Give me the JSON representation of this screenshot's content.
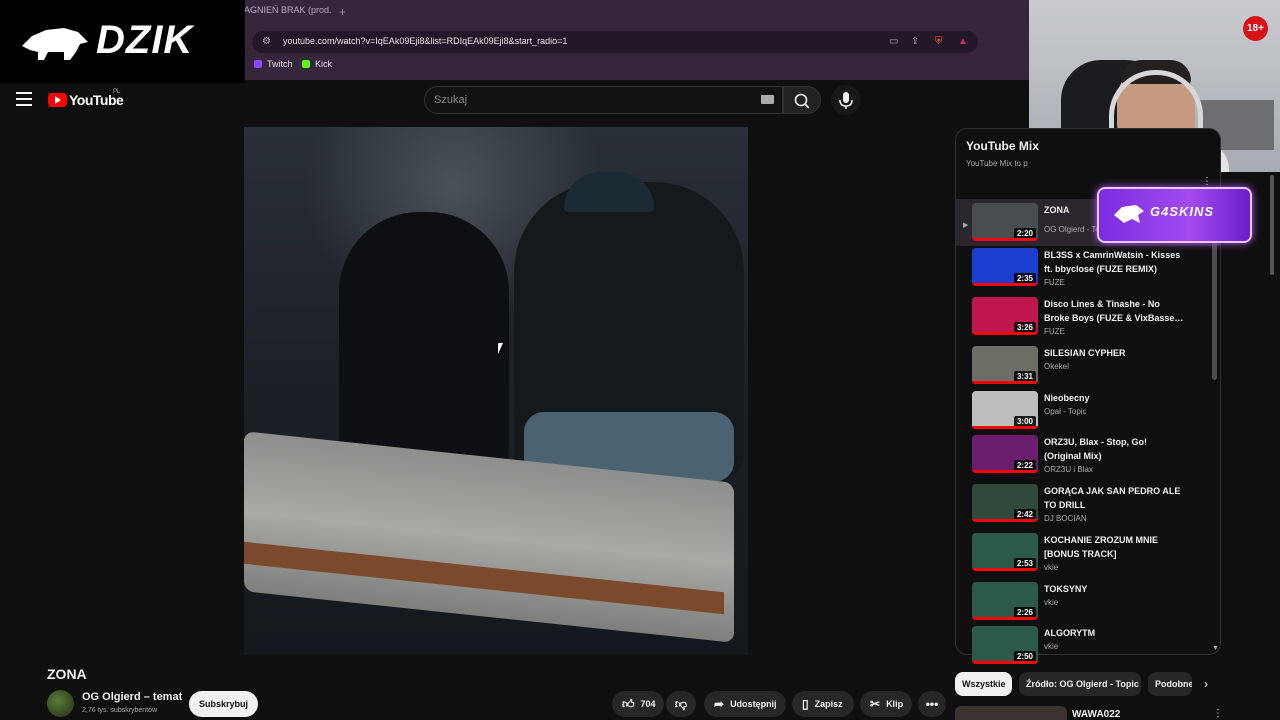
{
  "browser": {
    "tab_title": "AGNIEŃ BRAK (prod.",
    "new_tab": "+",
    "url": "youtube.com/watch?v=IqEAk09Eji8&list=RDIqEAk09Eji8&start_radio=1",
    "bookmarks": [
      {
        "label": "Twitch",
        "color": "#9146ff"
      },
      {
        "label": "Kick",
        "color": "#53fc18"
      }
    ]
  },
  "overlay": {
    "logo_text": "DZIK",
    "age_badge": "18+"
  },
  "youtube": {
    "logo_label": "YouTube",
    "region": "PL",
    "search_placeholder": "Szukaj"
  },
  "video": {
    "title": "ZONA",
    "channel_name": "OG Olgierd – temat",
    "channel_subs": "2,76 tys. subskrybentów",
    "subscribe_label": "Subskrybuj",
    "likes": "704",
    "share_label": "Udostępnij",
    "save_label": "Zapisz",
    "clip_label": "Klip"
  },
  "playlist": {
    "header": "YouTube Mix",
    "subheader": "YouTube Mix to p",
    "items": [
      {
        "title": "ZONA",
        "channel": "OG Olgierd - Topic",
        "duration": "2:20",
        "current": true,
        "thumb": "#4a4d4f"
      },
      {
        "title": "BL3SS x CamrinWatsin - Kisses ft. bbyclose (FUZE REMIX)",
        "channel": "FUZE",
        "duration": "2:35",
        "thumb": "#1a3fd0"
      },
      {
        "title": "Disco Lines & Tinashe - No Broke Boys (FUZE & VixBasse…",
        "channel": "FUZE",
        "duration": "3:26",
        "thumb": "#c0184e"
      },
      {
        "title": "SILESIAN CYPHER",
        "channel": "Okekel",
        "duration": "3:31",
        "thumb": "#6d6d66"
      },
      {
        "title": "Nieobecny",
        "channel": "Opał - Topic",
        "duration": "3:00",
        "thumb": "#bdbdbd"
      },
      {
        "title": "ORZ3U, Blax - Stop, Go! (Original Mix)",
        "channel": "ORZ3U i Blax",
        "duration": "2:22",
        "thumb": "#6b1e6e"
      },
      {
        "title": "GORĄCA JAK SAN PEDRO ALE TO DRILL",
        "channel": "DJ BOCIAN",
        "duration": "2:42",
        "thumb": "#2f4a3a"
      },
      {
        "title": "KOCHANIE ZROZUM MNIE [BONUS TRACK]",
        "channel": "vkie",
        "duration": "2:53",
        "thumb": "#2b5a48"
      },
      {
        "title": "TOKSYNY",
        "channel": "vkie",
        "duration": "2:26",
        "thumb": "#2b5a48"
      },
      {
        "title": "ALGORYTM",
        "channel": "vkie",
        "duration": "2:50",
        "thumb": "#2b5a48"
      }
    ]
  },
  "ad": {
    "text": "G4SKINS"
  },
  "chips": [
    {
      "label": "Wszystkie",
      "active": true
    },
    {
      "label": "Źródło: OG Olgierd - Topic",
      "active": false
    },
    {
      "label": "Podobne",
      "active": false
    }
  ],
  "recommended": {
    "title": "WAWA022"
  }
}
